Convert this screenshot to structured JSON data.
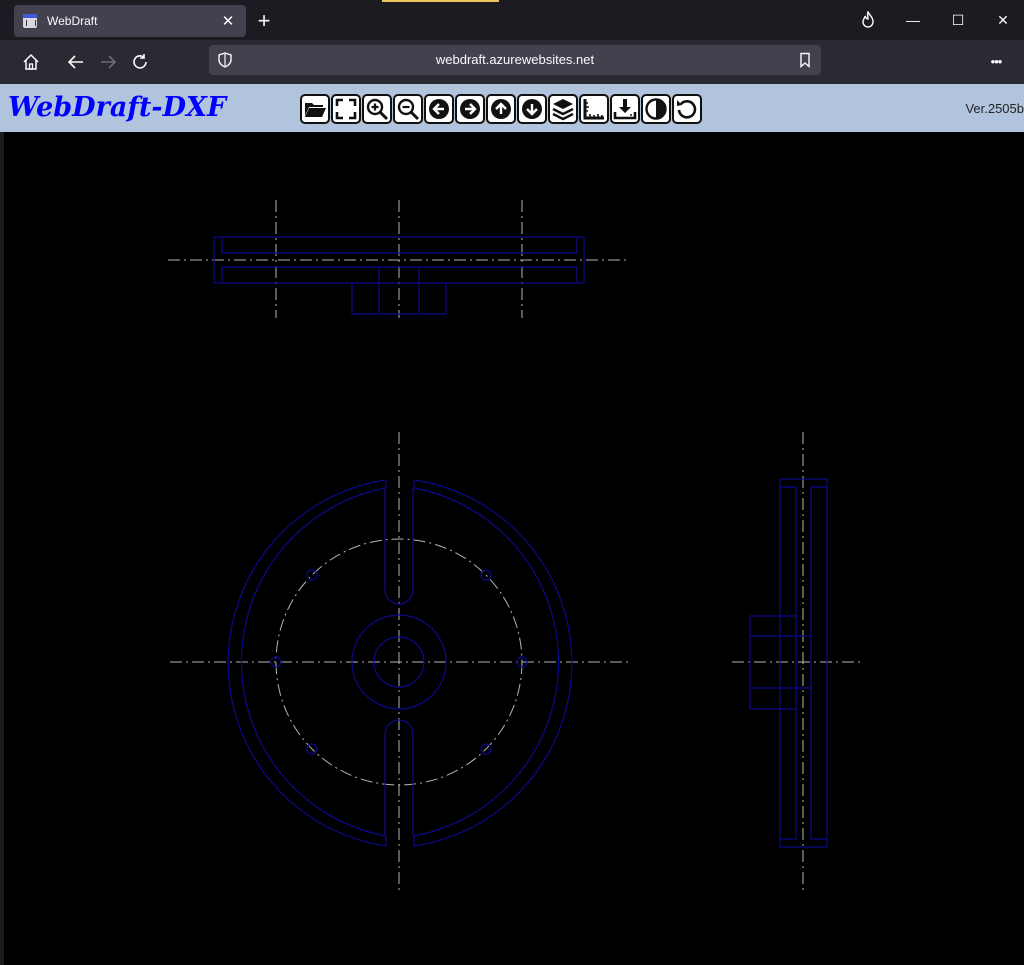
{
  "browser": {
    "tab_title": "WebDraft",
    "new_tab_label": "+",
    "url": "webdraft.azurewebsites.net",
    "menu_label": "•••"
  },
  "app": {
    "title": "WebDraft-DXF",
    "version": "Ver.2505b",
    "toolbar": [
      {
        "name": "open-file",
        "icon": "folder-open-icon"
      },
      {
        "name": "zoom-fit",
        "icon": "fit-screen-icon"
      },
      {
        "name": "zoom-in",
        "icon": "zoom-in-icon"
      },
      {
        "name": "zoom-out",
        "icon": "zoom-out-icon"
      },
      {
        "name": "pan-left",
        "icon": "arrow-left-circle-icon"
      },
      {
        "name": "pan-right",
        "icon": "arrow-right-circle-icon"
      },
      {
        "name": "pan-up",
        "icon": "arrow-up-circle-icon"
      },
      {
        "name": "pan-down",
        "icon": "arrow-down-circle-icon"
      },
      {
        "name": "layers",
        "icon": "layers-icon"
      },
      {
        "name": "measure",
        "icon": "ruler-corner-icon"
      },
      {
        "name": "download",
        "icon": "download-icon"
      },
      {
        "name": "contrast",
        "icon": "contrast-icon"
      },
      {
        "name": "reset",
        "icon": "undo-icon"
      }
    ],
    "colors": {
      "header_bg": "#b0c4de",
      "title": "#0000ff",
      "drawing_lines": "#0a0a8c",
      "center_lines": "#b4b4b4",
      "canvas_bg": "#000000"
    }
  }
}
